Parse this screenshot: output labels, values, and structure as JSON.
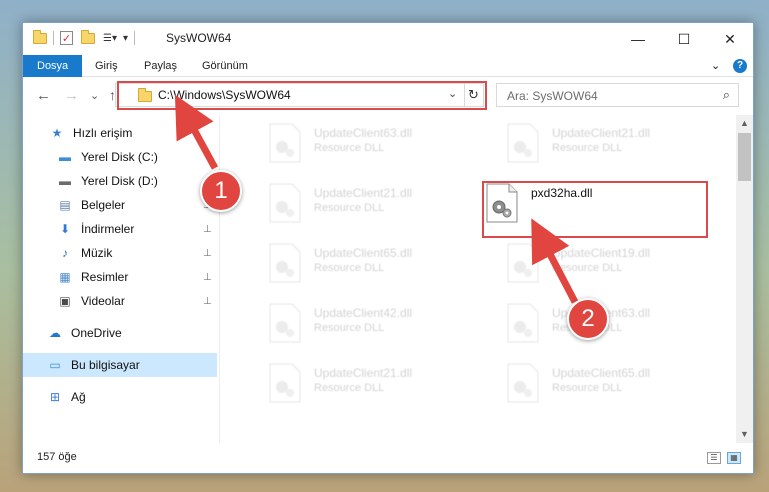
{
  "window": {
    "title": "SysWOW64",
    "minimize_glyph": "—",
    "maximize_glyph": "☐",
    "close_glyph": "✕"
  },
  "ribbon": {
    "tabs": [
      "Dosya",
      "Giriş",
      "Paylaş",
      "Görünüm"
    ],
    "active_tab": "Dosya",
    "expand_glyph": "⌄",
    "help_glyph": "?"
  },
  "nav": {
    "back_glyph": "←",
    "forward_glyph": "→",
    "recent_glyph": "⌄",
    "up_glyph": "↑",
    "address": "C:\\Windows\\SysWOW64",
    "dropdown_glyph": "⌄",
    "refresh_glyph": "↻",
    "search_placeholder": "Ara: SysWOW64",
    "search_glyph": "⌕"
  },
  "sidebar": {
    "items": [
      {
        "label": "Hızlı erişim",
        "icon": "star-icon",
        "glyph": "★",
        "color": "#3a7fd1",
        "pinned": false
      },
      {
        "label": "Yerel Disk (C:)",
        "icon": "drive-icon",
        "glyph": "▬",
        "color": "#3a8fd9",
        "pinned": false
      },
      {
        "label": "Yerel Disk (D:)",
        "icon": "drive-icon",
        "glyph": "▬",
        "color": "#6b6b6b",
        "pinned": false
      },
      {
        "label": "Belgeler",
        "icon": "documents-icon",
        "glyph": "▤",
        "color": "#5b7fa8",
        "pinned": true
      },
      {
        "label": "İndirmeler",
        "icon": "downloads-icon",
        "glyph": "⬇",
        "color": "#2f7bd6",
        "pinned": true
      },
      {
        "label": "Müzik",
        "icon": "music-icon",
        "glyph": "♪",
        "color": "#3b6fb5",
        "pinned": true
      },
      {
        "label": "Resimler",
        "icon": "pictures-icon",
        "glyph": "▦",
        "color": "#4b8bc9",
        "pinned": true
      },
      {
        "label": "Videolar",
        "icon": "videos-icon",
        "glyph": "▣",
        "color": "#4a4a4a",
        "pinned": true
      },
      {
        "label": "OneDrive",
        "icon": "cloud-icon",
        "glyph": "☁",
        "color": "#1f78d1",
        "pinned": false
      },
      {
        "label": "Bu bilgisayar",
        "icon": "computer-icon",
        "glyph": "▭",
        "color": "#3a8fd9",
        "pinned": false
      },
      {
        "label": "Ağ",
        "icon": "network-icon",
        "glyph": "⊞",
        "color": "#3a7fd1",
        "pinned": false
      }
    ],
    "selected": "Bu bilgisayar",
    "pin_glyph": "📌"
  },
  "files": {
    "blurred": [
      {
        "name": "UpdateClient63.dll",
        "type": "Resource DLL"
      },
      {
        "name": "UpdateClient21.dll",
        "type": "Resource DLL"
      },
      {
        "name": "UpdateClient21.dll",
        "type": "Resource DLL"
      },
      {
        "name": "UpdateClient65.dll",
        "type": "Resource DLL"
      },
      {
        "name": "UpdateClient19.dll",
        "type": "Resource DLL"
      },
      {
        "name": "UpdateClient42.dll",
        "type": "Resource DLL"
      },
      {
        "name": "UpdateClient63.dll",
        "type": "Resource DLL"
      },
      {
        "name": "UpdateClient21.dll",
        "type": "Resource DLL"
      },
      {
        "name": "UpdateClient65.dll",
        "type": "Resource DLL"
      }
    ],
    "highlighted": {
      "name": "pxd32ha.dll"
    }
  },
  "scrollbar": {
    "up_glyph": "▲",
    "down_glyph": "▼"
  },
  "status": {
    "item_count": "157 öğe",
    "details_view_glyph": "☰",
    "tiles_view_glyph": "▦"
  },
  "annotations": {
    "step1": "1",
    "step2": "2",
    "color": "#e0463f"
  }
}
